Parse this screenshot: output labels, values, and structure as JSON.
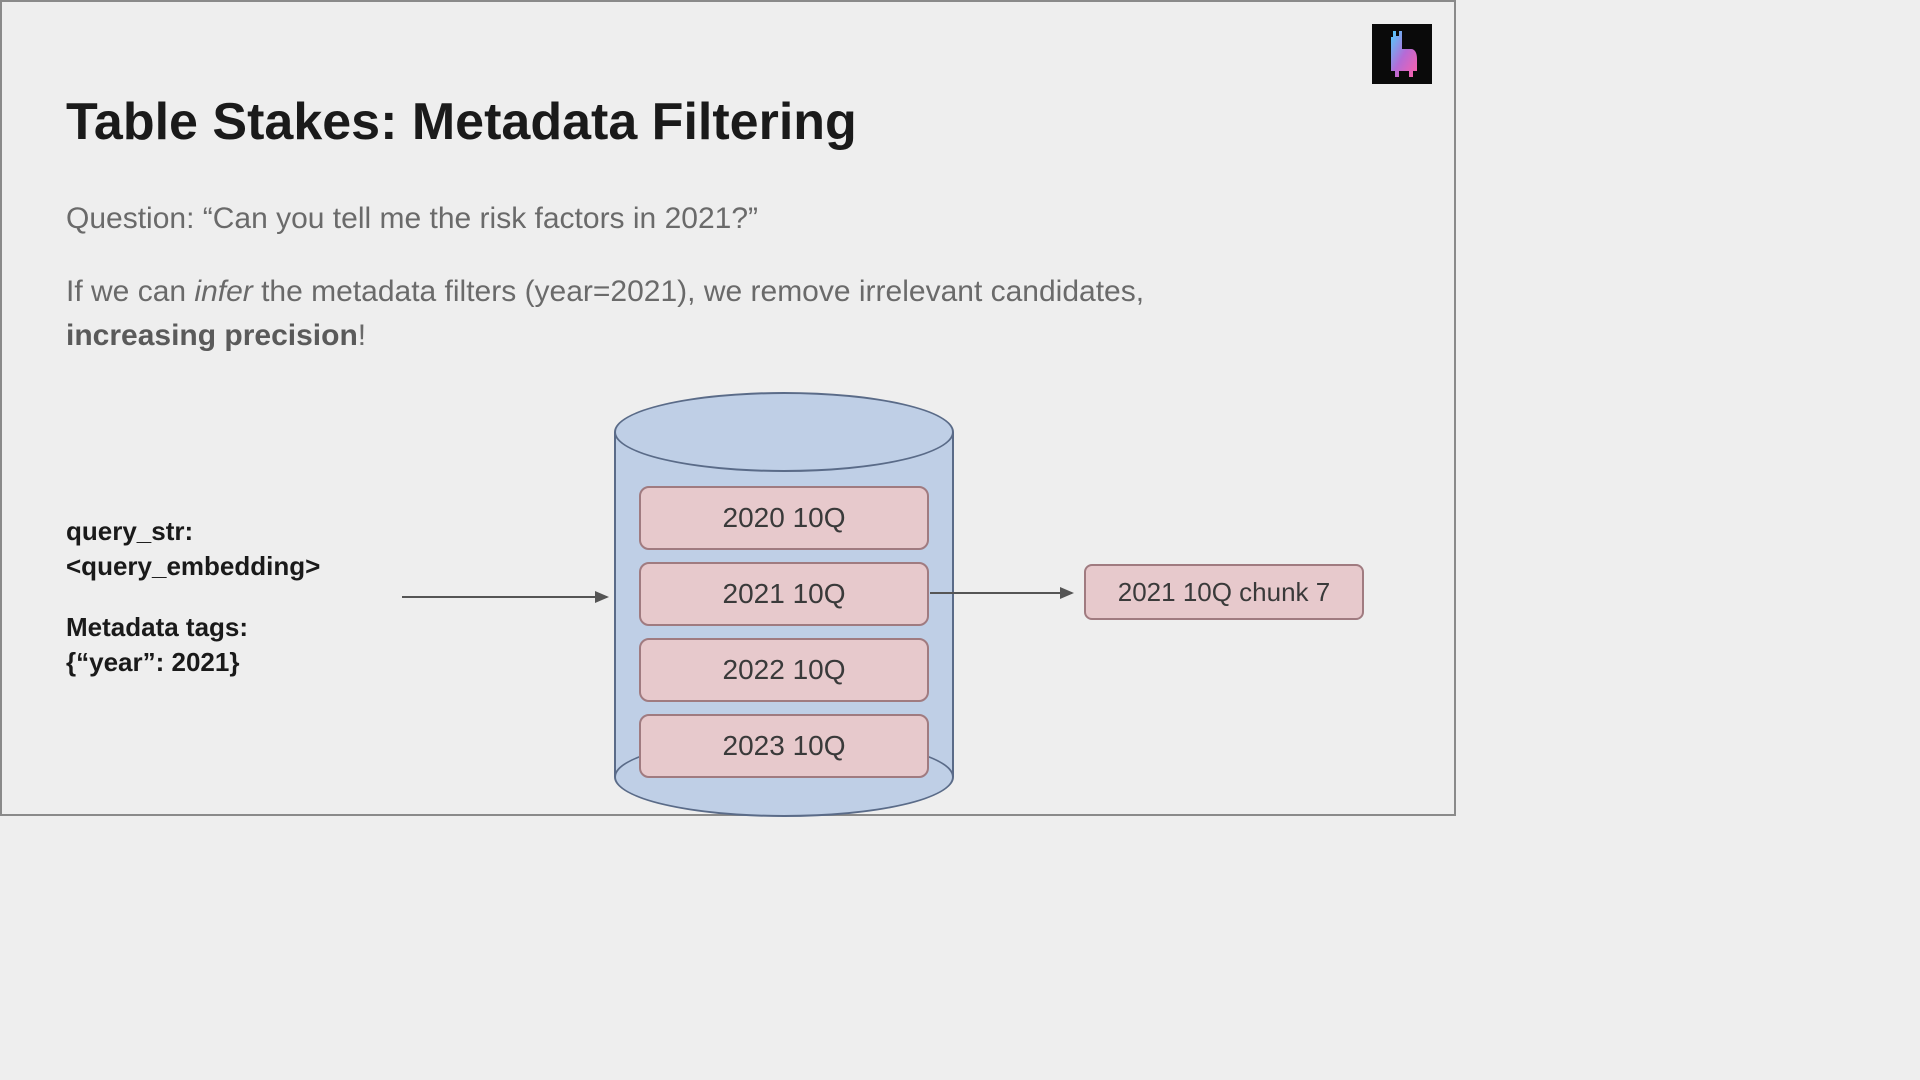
{
  "title": "Table Stakes: Metadata Filtering",
  "question": "Question: “Can you tell me the risk factors in 2021?”",
  "explain": {
    "pre": "If we can ",
    "italic": "infer",
    "mid": " the metadata filters (year=2021), we remove irrelevant candidates, ",
    "bold": "increasing precision",
    "post": "!"
  },
  "query": {
    "line1": "query_str:",
    "line2": "<query_embedding>",
    "line3_label": "Metadata tags:",
    "line4": "{“year”: 2021}"
  },
  "database": {
    "documents": [
      "2020 10Q",
      "2021 10Q",
      "2022 10Q",
      "2023 10Q"
    ]
  },
  "output": "2021 10Q chunk 7"
}
